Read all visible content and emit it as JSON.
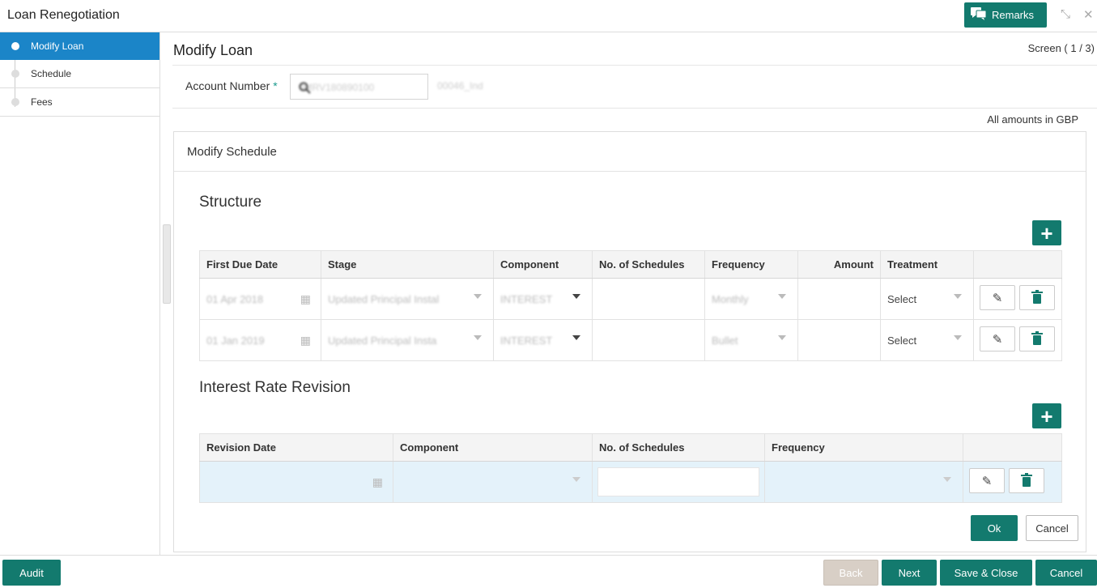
{
  "app": {
    "title": "Loan Renegotiation",
    "remarks_label": "Remarks"
  },
  "sidebar": {
    "items": [
      {
        "label": "Modify Loan",
        "active": true
      },
      {
        "label": "Schedule",
        "active": false
      },
      {
        "label": "Fees",
        "active": false
      }
    ]
  },
  "page": {
    "title": "Modify Loan",
    "screen_indicator": "Screen ( 1 / 3)",
    "account_label": "Account Number",
    "account_value": "0MRV180890100",
    "account_name": "00046_Ind",
    "amounts_note": "All amounts in GBP"
  },
  "card": {
    "title": "Modify Schedule"
  },
  "structure": {
    "title": "Structure",
    "columns": [
      "First Due Date",
      "Stage",
      "Component",
      "No. of Schedules",
      "Frequency",
      "Amount",
      "Treatment"
    ],
    "rows": [
      {
        "date": "01 Apr 2018",
        "stage": "Updated Principal Instal",
        "component": "INTEREST",
        "schedules": "",
        "frequency": "Monthly",
        "amount": "",
        "treatment": "Select"
      },
      {
        "date": "01 Jan 2019",
        "stage": "Updated Principal Insta",
        "component": "INTEREST",
        "schedules": "",
        "frequency": "Bullet",
        "amount": "",
        "treatment": "Select"
      }
    ]
  },
  "interest": {
    "title": "Interest Rate Revision",
    "columns": [
      "Revision Date",
      "Component",
      "No. of Schedules",
      "Frequency"
    ]
  },
  "buttons": {
    "ok": "Ok",
    "cancel": "Cancel"
  },
  "footer": {
    "audit": "Audit",
    "back": "Back",
    "next": "Next",
    "save_close": "Save & Close",
    "cancel": "Cancel"
  },
  "colors": {
    "accent": "#137a6e",
    "active_nav": "#1b85c8",
    "highlight_row": "#e4f2fa"
  }
}
